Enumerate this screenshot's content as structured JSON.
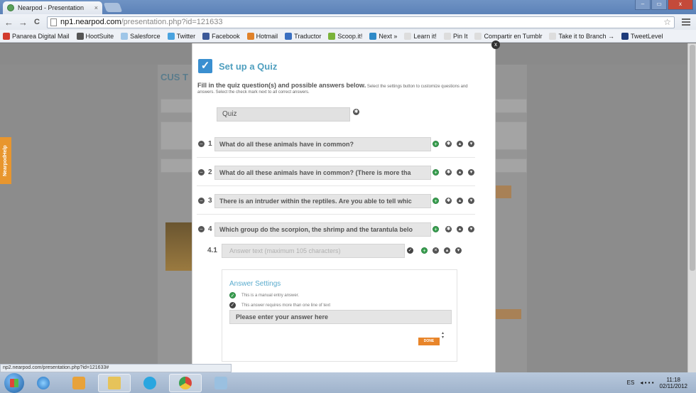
{
  "browser": {
    "tab_title": "Nearpod - Presentation",
    "tab_close": "×",
    "url_host": "np1.nearpod.com",
    "url_path": "/presentation.php?id=121633",
    "back": "←",
    "forward": "→",
    "reload": "C",
    "star": "☆",
    "win_min": "–",
    "win_max": "▭",
    "win_close": "x",
    "bookmarks": [
      {
        "label": "Panarea Digital Mail",
        "color": "#d23b2e"
      },
      {
        "label": "HootSuite",
        "color": "#555555"
      },
      {
        "label": "Salesforce",
        "color": "#9fc6e8"
      },
      {
        "label": "Twitter",
        "color": "#4aa3df"
      },
      {
        "label": "Facebook",
        "color": "#3b5998"
      },
      {
        "label": "Hotmail",
        "color": "#e0822a"
      },
      {
        "label": "Traductor",
        "color": "#3a6fc0"
      },
      {
        "label": "Scoop.it!",
        "color": "#7ab33a"
      },
      {
        "label": "Next »",
        "color": "#2e8ac8"
      },
      {
        "label": "Learn it!",
        "color": "#dddddd"
      },
      {
        "label": "Pin It",
        "color": "#dddddd"
      },
      {
        "label": "Compartir en Tumblr",
        "color": "#dddddd"
      },
      {
        "label": "Take it to Branch →",
        "color": "#dddddd"
      },
      {
        "label": "TweetLevel",
        "color": "#1d3a7a"
      }
    ],
    "status_url": "np2.nearpod.com/presentation.php?id=121633#"
  },
  "background": {
    "title": "CUS T",
    "side_tab": "NearpodHelp"
  },
  "modal": {
    "close": "x",
    "title": "Set up a Quiz",
    "instructions_bold": "Fill in the quiz question(s) and possible answers below.",
    "instructions_rest": "Select the settings button to customize questions and answers. Select the check mark next to all correct answers.",
    "quiz_name": "Quiz",
    "questions": [
      {
        "num": "1",
        "text": "What do all these animals have in common?"
      },
      {
        "num": "2",
        "text": "What do all these animals have in common? (There is more tha"
      },
      {
        "num": "3",
        "text": "There is an intruder within the reptiles. Are you able to tell whic"
      },
      {
        "num": "4",
        "text": "Which group do the scorpion, the shrimp and the tarantula belo"
      }
    ],
    "answer": {
      "num": "4.1",
      "placeholder": "Answer text (maximum 105 characters)"
    },
    "settings": {
      "title": "Answer Settings",
      "opt1": "This is a manual entry answer.",
      "opt2": "This answer requires more than one line of text",
      "input_value": "Please enter your answer here",
      "done": "DONE"
    }
  },
  "taskbar": {
    "lang": "ES",
    "time": "11:18",
    "date": "02/11/2012"
  }
}
